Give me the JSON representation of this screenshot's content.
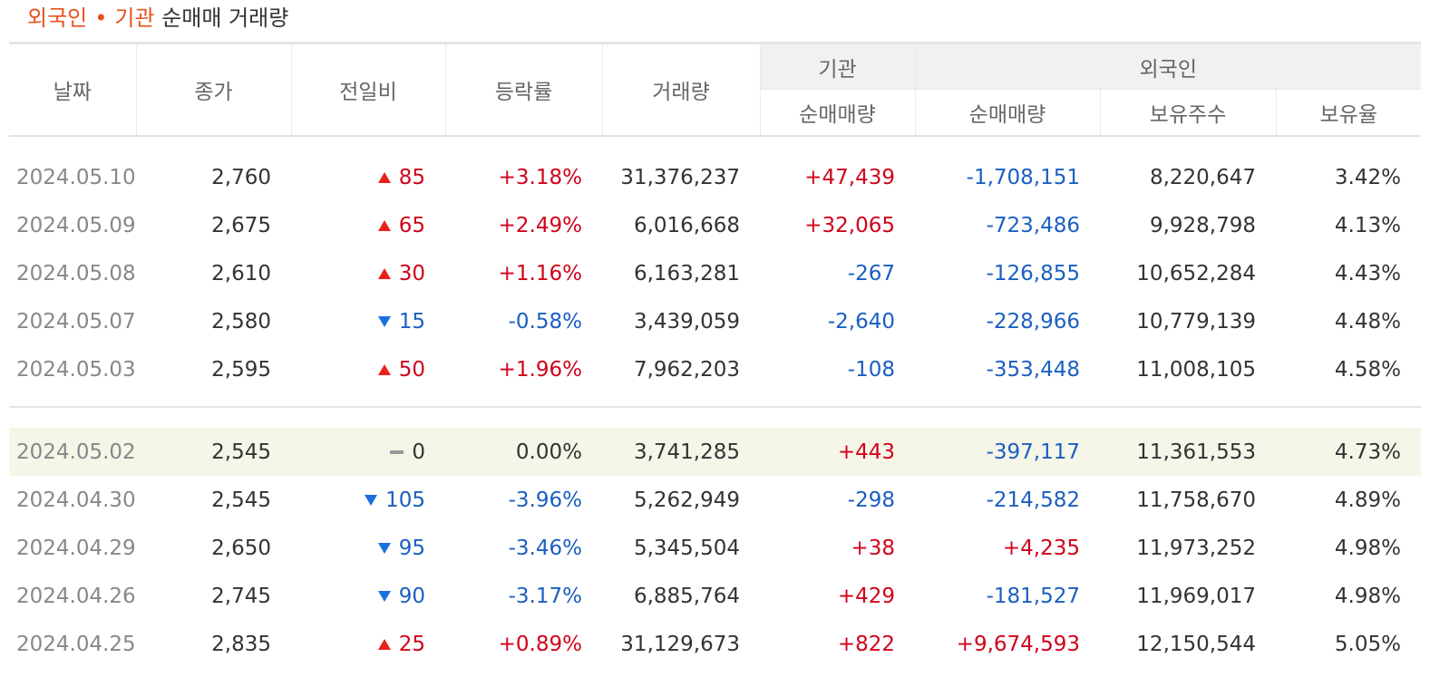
{
  "title": {
    "part1": "외국인",
    "dot": "•",
    "part2": "기관",
    "rest": "순매매 거래량"
  },
  "headers": {
    "date": "날짜",
    "close": "종가",
    "change": "전일비",
    "rate": "등락률",
    "volume": "거래량",
    "group_inst": "기관",
    "group_foreign": "외국인",
    "inst_net": "순매매량",
    "foreign_net": "순매매량",
    "foreign_hold": "보유주수",
    "foreign_ratio": "보유율"
  },
  "colors": {
    "accent": "#e8521e",
    "up": "#d0021b",
    "down": "#1a5fc2",
    "highlight_row": "#f5f5e8"
  },
  "rows_a": [
    {
      "date": "2024.05.10",
      "close": "2,760",
      "dir": "up",
      "change": "85",
      "rate": "+3.18%",
      "volume": "31,376,237",
      "inst": "+47,439",
      "foreign": "-1,708,151",
      "hold": "8,220,647",
      "ratio": "3.42%"
    },
    {
      "date": "2024.05.09",
      "close": "2,675",
      "dir": "up",
      "change": "65",
      "rate": "+2.49%",
      "volume": "6,016,668",
      "inst": "+32,065",
      "foreign": "-723,486",
      "hold": "9,928,798",
      "ratio": "4.13%"
    },
    {
      "date": "2024.05.08",
      "close": "2,610",
      "dir": "up",
      "change": "30",
      "rate": "+1.16%",
      "volume": "6,163,281",
      "inst": "-267",
      "foreign": "-126,855",
      "hold": "10,652,284",
      "ratio": "4.43%"
    },
    {
      "date": "2024.05.07",
      "close": "2,580",
      "dir": "down",
      "change": "15",
      "rate": "-0.58%",
      "volume": "3,439,059",
      "inst": "-2,640",
      "foreign": "-228,966",
      "hold": "10,779,139",
      "ratio": "4.48%"
    },
    {
      "date": "2024.05.03",
      "close": "2,595",
      "dir": "up",
      "change": "50",
      "rate": "+1.96%",
      "volume": "7,962,203",
      "inst": "-108",
      "foreign": "-353,448",
      "hold": "11,008,105",
      "ratio": "4.58%"
    }
  ],
  "rows_b": [
    {
      "date": "2024.05.02",
      "close": "2,545",
      "dir": "flat",
      "change": "0",
      "rate": "0.00%",
      "volume": "3,741,285",
      "inst": "+443",
      "foreign": "-397,117",
      "hold": "11,361,553",
      "ratio": "4.73%"
    },
    {
      "date": "2024.04.30",
      "close": "2,545",
      "dir": "down",
      "change": "105",
      "rate": "-3.96%",
      "volume": "5,262,949",
      "inst": "-298",
      "foreign": "-214,582",
      "hold": "11,758,670",
      "ratio": "4.89%"
    },
    {
      "date": "2024.04.29",
      "close": "2,650",
      "dir": "down",
      "change": "95",
      "rate": "-3.46%",
      "volume": "5,345,504",
      "inst": "+38",
      "foreign": "+4,235",
      "hold": "11,973,252",
      "ratio": "4.98%"
    },
    {
      "date": "2024.04.26",
      "close": "2,745",
      "dir": "down",
      "change": "90",
      "rate": "-3.17%",
      "volume": "6,885,764",
      "inst": "+429",
      "foreign": "-181,527",
      "hold": "11,969,017",
      "ratio": "4.98%"
    },
    {
      "date": "2024.04.25",
      "close": "2,835",
      "dir": "up",
      "change": "25",
      "rate": "+0.89%",
      "volume": "31,129,673",
      "inst": "+822",
      "foreign": "+9,674,593",
      "hold": "12,150,544",
      "ratio": "5.05%"
    }
  ]
}
